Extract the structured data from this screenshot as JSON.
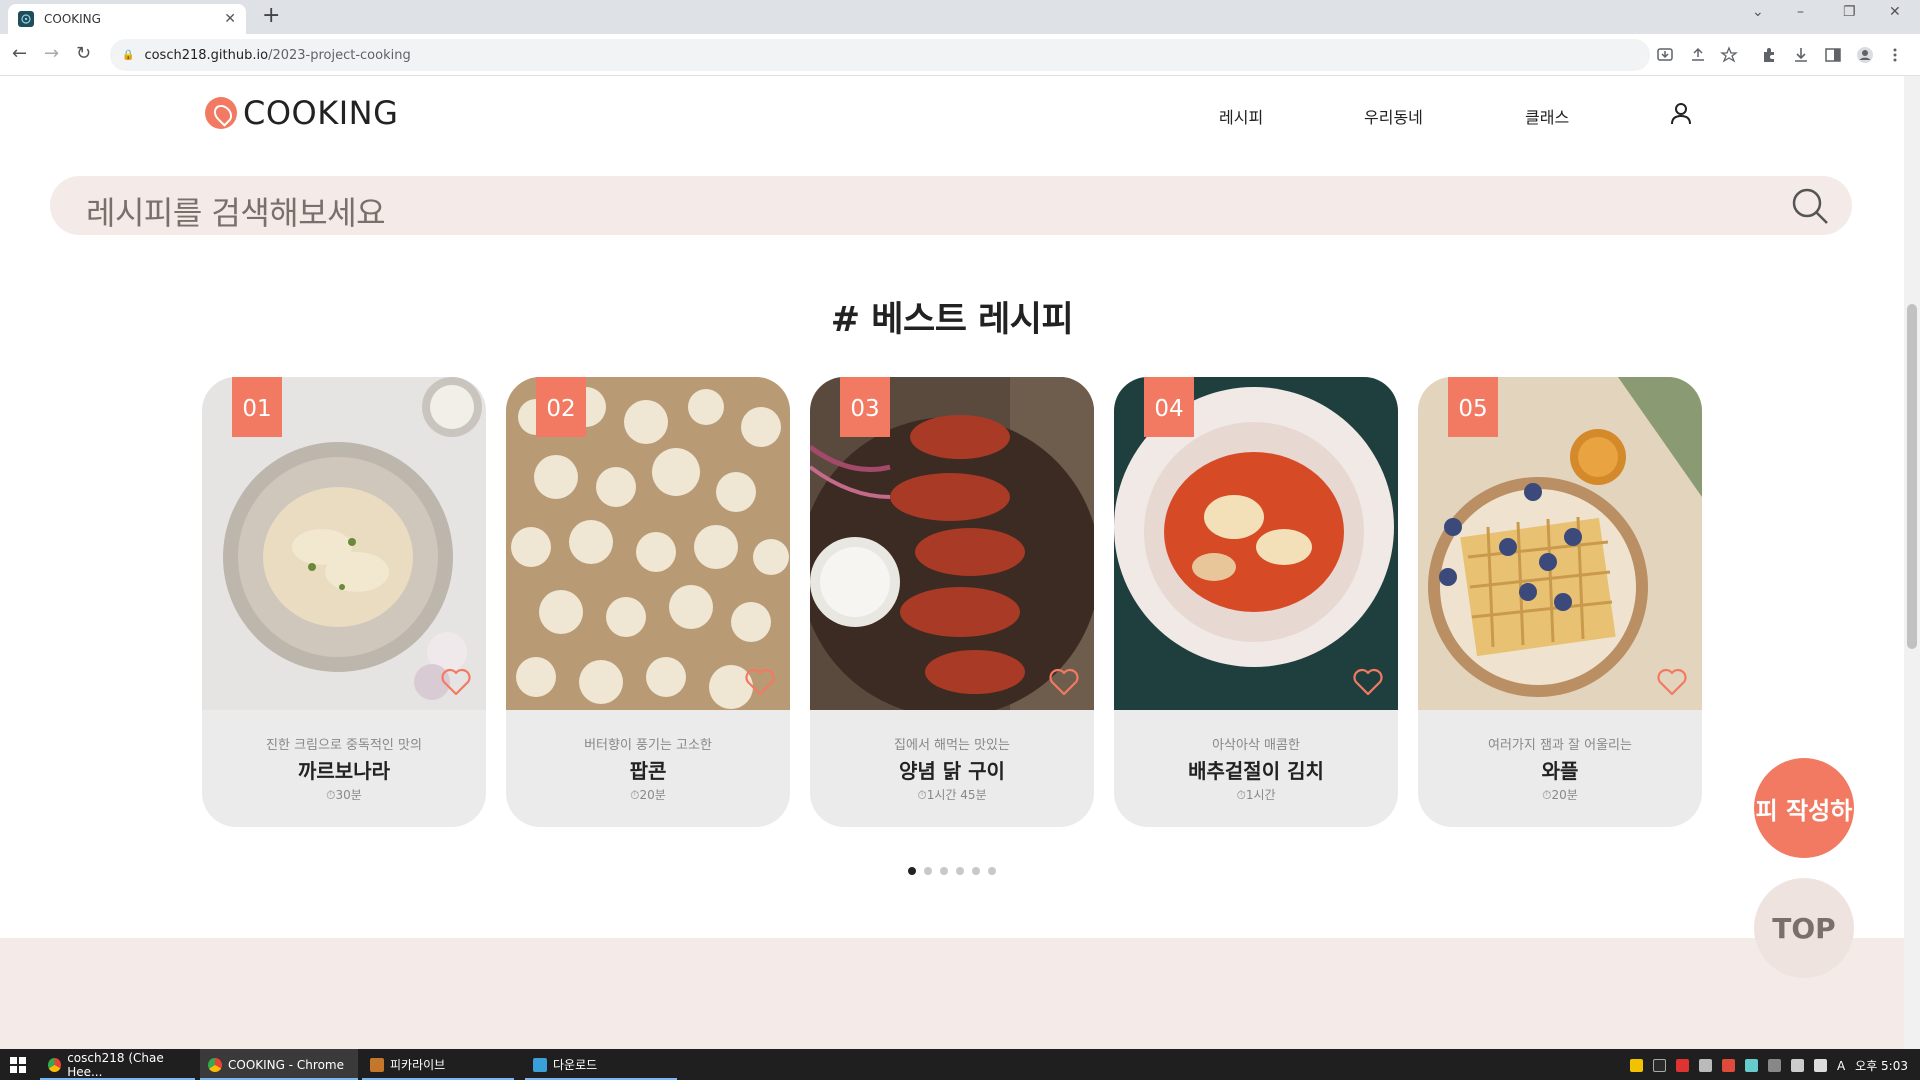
{
  "browser": {
    "tab_title": "COOKING",
    "url_host": "cosch218.github.io",
    "url_path": "/2023-project-cooking",
    "new_tab": "+",
    "tab_close": "✕"
  },
  "site": {
    "logo": "COOKING",
    "nav": [
      "레시피",
      "우리동네",
      "클래스"
    ],
    "search_placeholder": "레시피를 검색해보세요",
    "section_title": "# 베스트 레시피"
  },
  "recipes": [
    {
      "rank": "01",
      "subtitle": "진한 크림으로 중독적인 맛의",
      "name": "까르보나라",
      "time": "30분"
    },
    {
      "rank": "02",
      "subtitle": "버터향이 풍기는 고소한",
      "name": "팝콘",
      "time": "20분"
    },
    {
      "rank": "03",
      "subtitle": "집에서 해먹는 맛있는",
      "name": "양념 닭 구이",
      "time": "1시간 45분"
    },
    {
      "rank": "04",
      "subtitle": "아삭아삭 매콤한",
      "name": "배추겉절이 김치",
      "time": "1시간"
    },
    {
      "rank": "05",
      "subtitle": "여러가지 잼과 잘 어울리는",
      "name": "와플",
      "time": "20분"
    }
  ],
  "pagination": {
    "count": 6,
    "active_index": 0
  },
  "floating": {
    "write_label": "피 작성하",
    "top_label": "TOP"
  },
  "taskbar": {
    "items": [
      "cosch218 (Chae Hee...",
      "COOKING - Chrome",
      "피카라이브",
      "다운로드"
    ],
    "clock": "오후 5:03",
    "ime": "A"
  },
  "colors": {
    "accent": "#f27a62",
    "search_bg": "#f4ebe8",
    "card_bg": "#ebebeb"
  }
}
